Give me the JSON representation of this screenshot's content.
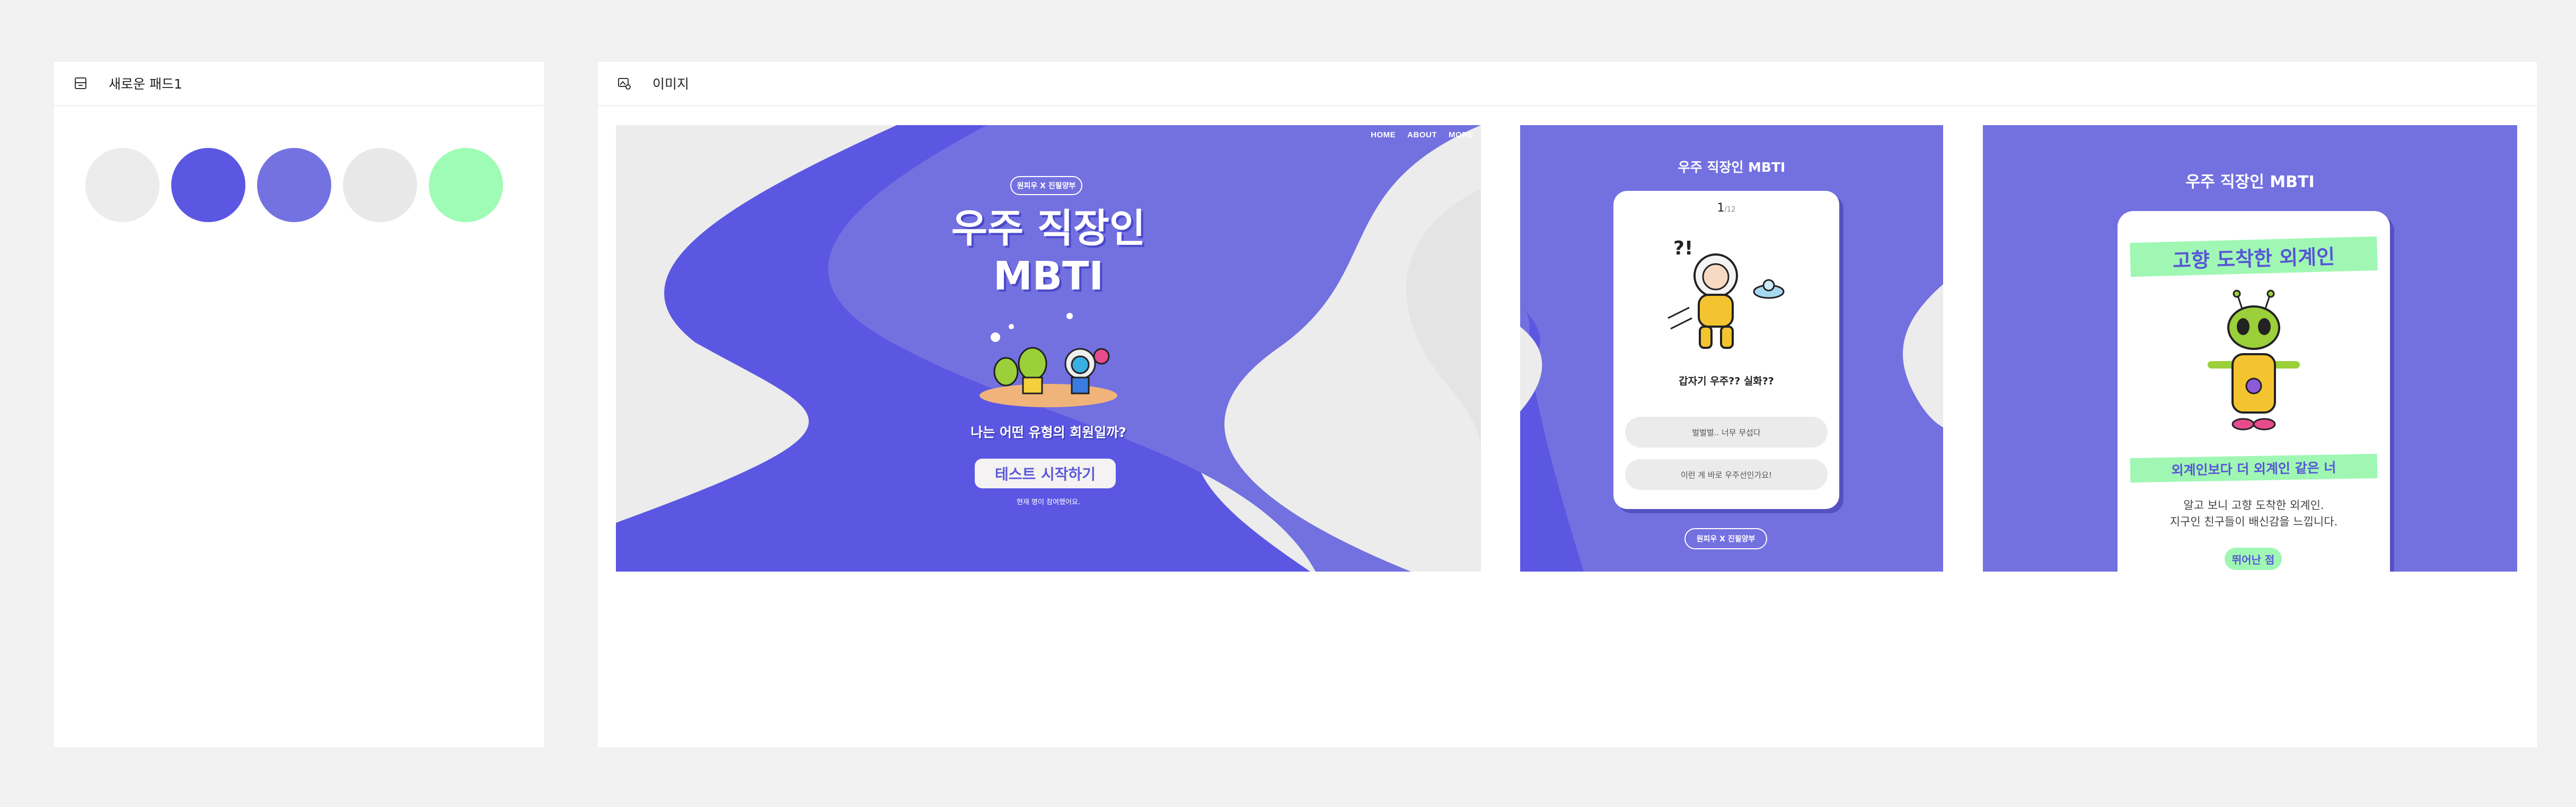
{
  "colors": {
    "canvas": "#f2f2f2",
    "primary_dark": "#5b57e3",
    "primary": "#7370e0",
    "light_gray": "#ebebeb",
    "mint": "#9ff7b3"
  },
  "pad_panel": {
    "icon": "drawer-icon",
    "title": "새로운 패드1",
    "swatches": [
      {
        "name": "light-gray-1",
        "color": "#ececec"
      },
      {
        "name": "indigo",
        "color": "#5b57e3"
      },
      {
        "name": "periwinkle",
        "color": "#7472e1"
      },
      {
        "name": "light-gray-2",
        "color": "#e8e8e8"
      },
      {
        "name": "mint",
        "color": "#9ffcb4"
      }
    ]
  },
  "image_panel": {
    "icon": "image-icon",
    "title": "이미지"
  },
  "shot1": {
    "nav": [
      "HOME",
      "ABOUT",
      "MORE"
    ],
    "badge": "원피우 X 진필양부",
    "title_line1": "우주 직장인",
    "title_line2": "MBTI",
    "subtitle": "나는 어떤 유형의 회원일까?",
    "start_button": "테스트 시작하기",
    "note": "현재 명이 참여했어요."
  },
  "shot2": {
    "title": "우주 직장인 MBTI",
    "progress_current": "1",
    "progress_total": "/12",
    "question": "갑자기 우주?? 실화??",
    "answers": [
      "벌벌벌.. 너무 무섭다",
      "이런 게 바로 우주선인가요!"
    ],
    "footer_badge": "원피우 X 진필양부"
  },
  "shot3": {
    "title": "우주 직장인 MBTI",
    "result_name": "고향 도착한 외계인",
    "result_tagline": "외계인보다 더 외계인 같은 너",
    "description_line1": "알고 보니 고향 도착한 외계인.",
    "description_line2": "지구인 친구들이 배신감을 느낍니다.",
    "strength_label": "뛰어난 점"
  }
}
